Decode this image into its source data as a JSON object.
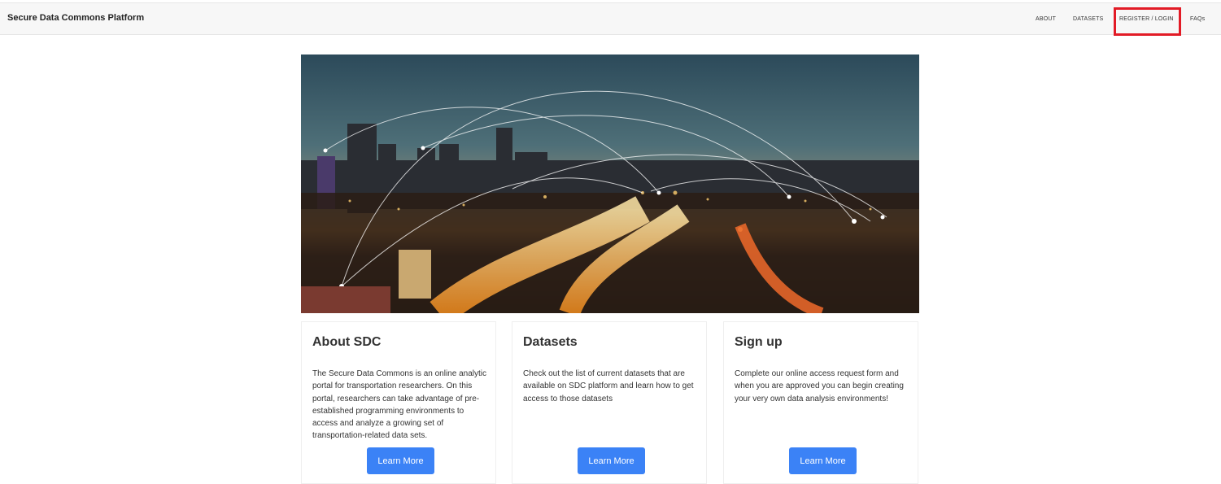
{
  "navbar": {
    "brand": "Secure Data Commons Platform",
    "links": [
      {
        "label": "ABOUT"
      },
      {
        "label": "DATASETS"
      },
      {
        "label": "REGISTER / LOGIN"
      },
      {
        "label": "FAQs"
      }
    ]
  },
  "hero": {
    "image": "city-highway-night-network-image"
  },
  "cards": [
    {
      "title": "About SDC",
      "text": "The Secure Data Commons is an online analytic portal for transportation researchers. On this portal, researchers can take advantage of pre-established programming environments to access and analyze a growing set of transportation-related data sets.",
      "button": "Learn More"
    },
    {
      "title": "Datasets",
      "text": "Check out the list of current datasets that are available on SDC platform and learn how to get access to those datasets",
      "button": "Learn More"
    },
    {
      "title": "Sign up",
      "text": "Complete our online access request form and when you are approved you can begin creating your very own data analysis environments!",
      "button": "Learn More"
    }
  ],
  "colors": {
    "highlight": "#e21b26",
    "button": "#3b82f6",
    "navbar_bg": "#f7f7f7"
  }
}
